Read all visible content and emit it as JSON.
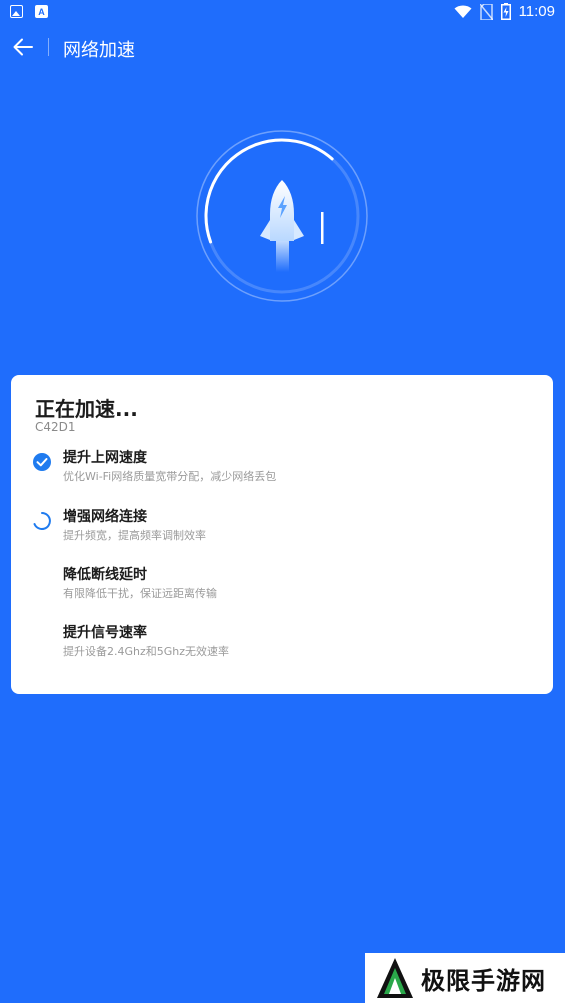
{
  "status_bar": {
    "time": "11:09",
    "left_icons": [
      "image-notification-icon",
      "a-notification-icon"
    ],
    "right_icons": [
      "wifi-icon",
      "no-sim-icon",
      "battery-charging-icon"
    ]
  },
  "toolbar": {
    "back_icon": "arrow-left-icon",
    "title": "网络加速"
  },
  "hero": {
    "icon": "rocket-icon",
    "progress": 0.42
  },
  "card": {
    "title": "正在加速...",
    "subtitle": "C42D1",
    "steps": [
      {
        "name": "提升上网速度",
        "desc": "优化Wi-Fi网络质量宽带分配，减少网络丢包",
        "status": "done"
      },
      {
        "name": "增强网络连接",
        "desc": "提升频宽，提高频率调制效率",
        "status": "loading"
      },
      {
        "name": "降低断线延时",
        "desc": "有限降低干扰，保证远距离传输",
        "status": "pending"
      },
      {
        "name": "提升信号速率",
        "desc": "提升设备2.4Ghz和5Ghz无效速率",
        "status": "pending"
      }
    ]
  },
  "watermark": {
    "text": "极限手游网"
  },
  "colors": {
    "background": "#1f6dfc",
    "accent": "#1f7bef",
    "card": "#ffffff"
  }
}
